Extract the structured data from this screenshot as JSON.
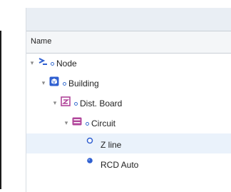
{
  "tree": {
    "column_header": "Name",
    "rows": [
      {
        "label": "Node",
        "icon": "node-prompt-icon",
        "expanded": true
      },
      {
        "label": "Building",
        "icon": "building-cube-icon",
        "expanded": true
      },
      {
        "label": "Dist. Board",
        "icon": "distribution-board-icon",
        "expanded": true
      },
      {
        "label": "Circuit",
        "icon": "circuit-icon",
        "expanded": true
      },
      {
        "label": "Z line",
        "icon": "test-open-circle-icon",
        "selected": true
      },
      {
        "label": "RCD Auto",
        "icon": "test-filled-circle-icon"
      }
    ]
  },
  "colors": {
    "accent": "#2f5fd0",
    "circuit_pink": "#b0459a",
    "selected_row": "#eaf2fb",
    "panel_top": "#e9eef4"
  }
}
